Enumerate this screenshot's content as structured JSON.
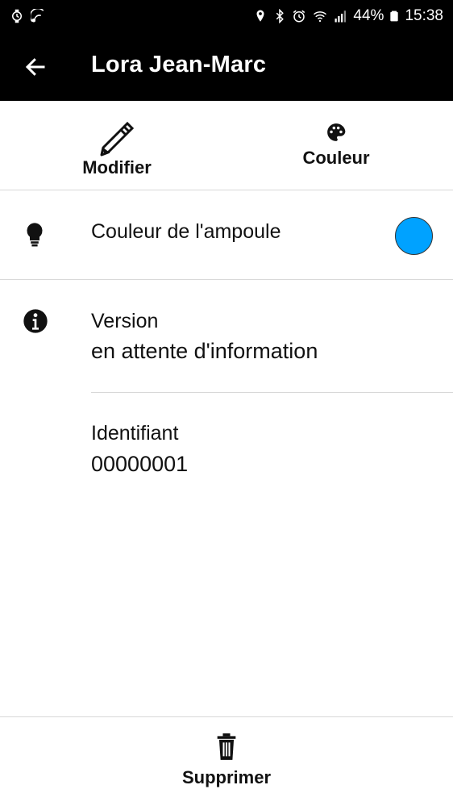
{
  "statusbar": {
    "battery_percent": "44%",
    "time": "15:38",
    "icons_left": [
      "watch-icon",
      "cast-icon"
    ],
    "icons_right": [
      "location-icon",
      "bluetooth-icon",
      "alarm-icon",
      "wifi-icon",
      "signal-icon",
      "battery-icon"
    ]
  },
  "appbar": {
    "title": "Lora Jean-Marc",
    "back_icon": "arrow-left-icon"
  },
  "actions": {
    "modifier_label": "Modifier",
    "couleur_label": "Couleur"
  },
  "ampoule": {
    "label": "Couleur de l'ampoule",
    "color": "#00a2ff"
  },
  "info": {
    "version_label": "Version",
    "version_value": "en attente d'information",
    "id_label": "Identifiant",
    "id_value": "00000001"
  },
  "bottom": {
    "delete_label": "Supprimer"
  }
}
